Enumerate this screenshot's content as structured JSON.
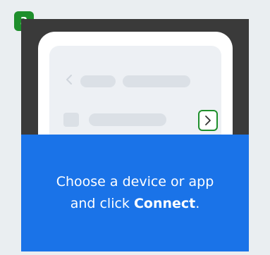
{
  "step": {
    "number": "3"
  },
  "icons": {
    "back": "chevron-left-icon",
    "connect": "chevron-right-icon",
    "row_arrow": "chevron-right-icon"
  },
  "caption": {
    "line1": "Choose a device or app",
    "line2_prefix": "and click ",
    "line2_bold": "Connect",
    "line2_suffix": "."
  },
  "colors": {
    "background": "#eaeef1",
    "badge": "#1e8f2c",
    "highlight": "#1e8f2c",
    "caption_bg": "#1a73e8",
    "frame": "#3a3a3a",
    "skeleton": "#dbe0e6"
  }
}
